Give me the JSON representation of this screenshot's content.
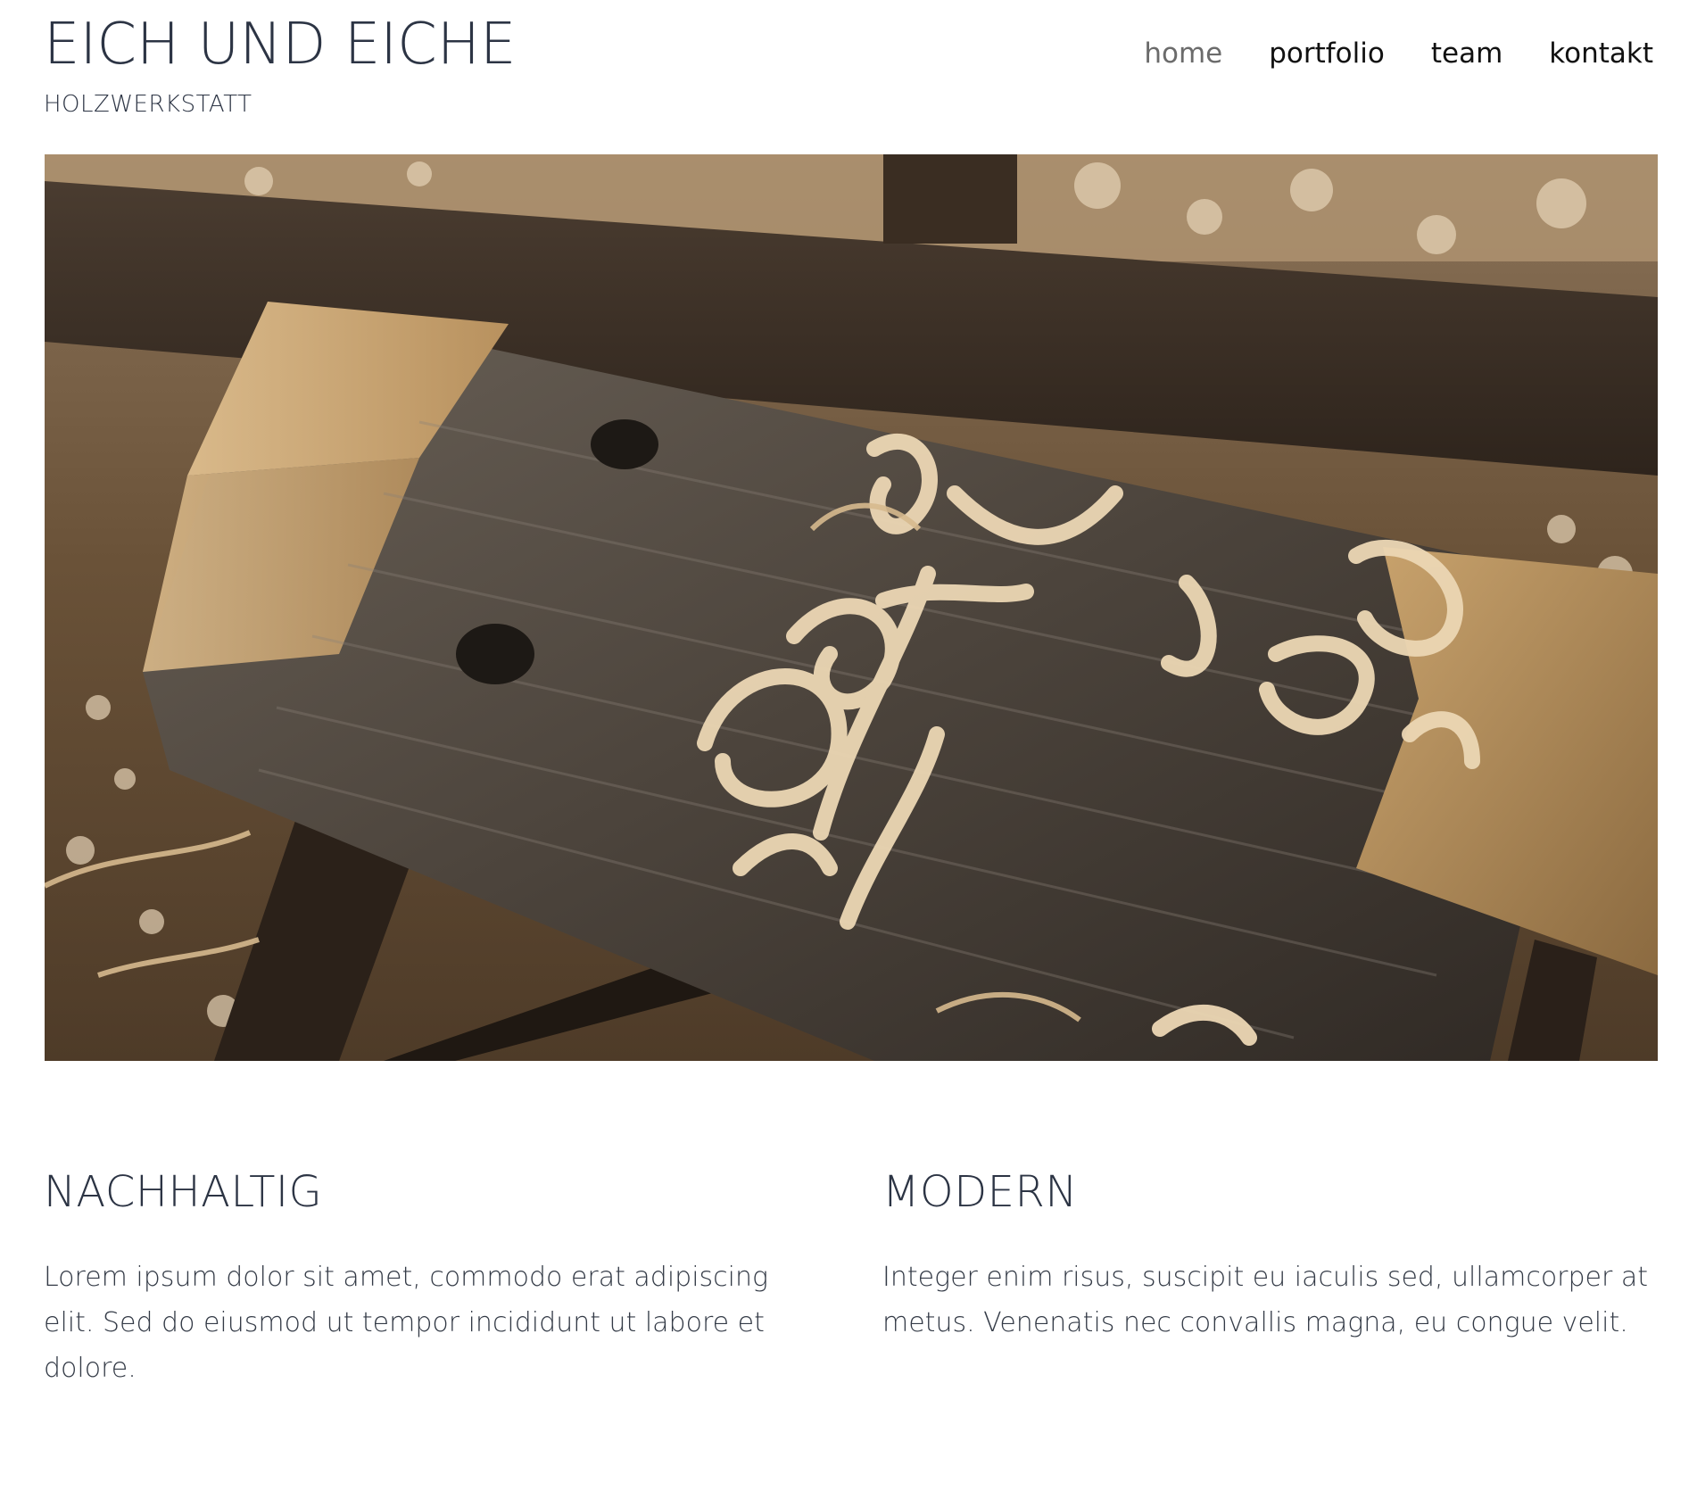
{
  "brand": {
    "title": "EICH UND EICHE",
    "subtitle": "HOLZWERKSTATT"
  },
  "nav": {
    "items": [
      {
        "label": "home",
        "active": true
      },
      {
        "label": "portfolio",
        "active": false
      },
      {
        "label": "team",
        "active": false
      },
      {
        "label": "kontakt",
        "active": false
      }
    ]
  },
  "hero": {
    "image_icon": "woodworking-photo"
  },
  "features": [
    {
      "heading": "NACHHALTIG",
      "text": "Lorem ipsum dolor sit amet, commodo erat adipiscing elit. Sed do eiusmod ut tempor incididunt ut labore et dolore."
    },
    {
      "heading": "MODERN",
      "text": "Integer enim risus, suscipit eu iaculis sed, ullamcorper at metus. Venenatis nec convallis magna, eu congue velit."
    }
  ],
  "colors": {
    "text": "#2c3444",
    "nav_active": "#6b6b6b",
    "nav": "#111111",
    "background": "#ffffff"
  }
}
